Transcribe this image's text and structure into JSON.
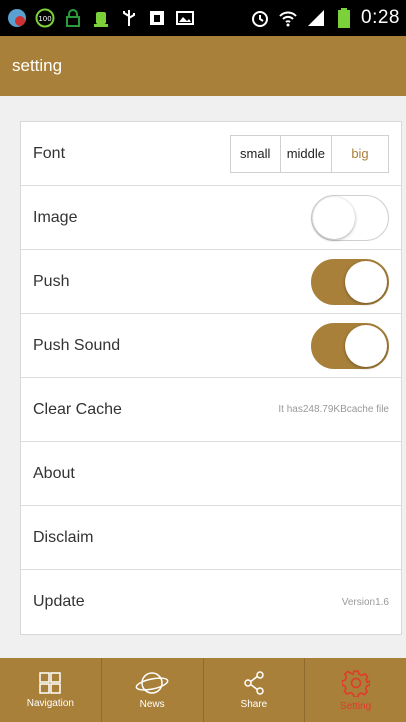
{
  "status_bar": {
    "time": "0:28",
    "icons": [
      "app-icon",
      "battery-100-icon",
      "lock-icon",
      "android-icon",
      "usb-icon",
      "sim-icon",
      "image-icon",
      "alarm-icon",
      "wifi-icon",
      "signal-icon",
      "battery-icon"
    ]
  },
  "header": {
    "title": "setting"
  },
  "settings": {
    "font": {
      "label": "Font",
      "options": [
        "small",
        "middle",
        "big"
      ],
      "selected": "big"
    },
    "image": {
      "label": "Image",
      "enabled": false
    },
    "push": {
      "label": "Push",
      "enabled": true
    },
    "push_sound": {
      "label": "Push Sound",
      "enabled": true
    },
    "clear_cache": {
      "label": "Clear Cache",
      "info": "It has248.79KBcache file"
    },
    "about": {
      "label": "About"
    },
    "disclaim": {
      "label": "Disclaim"
    },
    "update": {
      "label": "Update",
      "info": "Version1.6"
    }
  },
  "bottom_nav": {
    "items": [
      {
        "label": "Navigation",
        "icon": "grid-icon"
      },
      {
        "label": "News",
        "icon": "planet-icon"
      },
      {
        "label": "Share",
        "icon": "share-icon"
      },
      {
        "label": "Setting",
        "icon": "gear-icon",
        "active": true
      }
    ]
  },
  "colors": {
    "accent": "#a8803a",
    "active_nav": "#e03b2a"
  }
}
